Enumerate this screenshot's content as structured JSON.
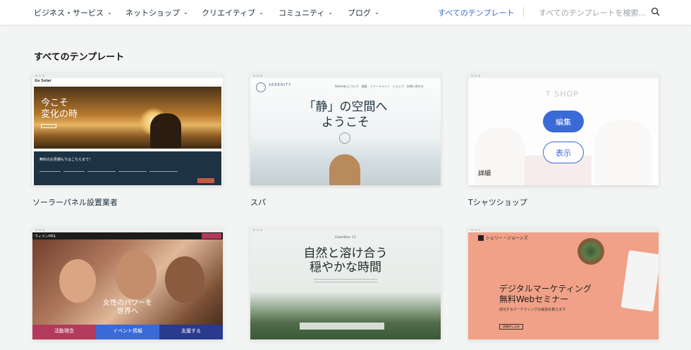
{
  "nav": {
    "items": [
      "ビジネス・サービス",
      "ネットショップ",
      "クリエイティブ",
      "コミュニティ",
      "ブログ"
    ],
    "active": "すべてのテンプレート",
    "search_placeholder": "すべてのテンプレートを検索..."
  },
  "page": {
    "title": "すべてのテンプレート"
  },
  "cards": [
    {
      "name": "ソーラーパネル設置業者",
      "preview": {
        "logo": "Go Solar",
        "headline": "今こそ\n変化の時",
        "form_title": "無料のお見積もりはこちらまで！"
      }
    },
    {
      "name": "スパ",
      "preview": {
        "brand": "SERENITY",
        "menu": "Serenity について　施設　トリートメント　ショップ　お問い合わせ",
        "headline": "「静」の空間へ\nようこそ"
      }
    },
    {
      "name": "Tシャツショップ",
      "preview": {
        "shop": "T SHOP",
        "detail": "詳細",
        "edit_label": "編集",
        "view_label": "表示"
      }
    },
    {
      "name": "",
      "preview": {
        "logo": "ウィメンPRS",
        "headline": "女性のパワーを\n世界へ",
        "tabs": [
          "活動理念",
          "イベント情報",
          "支援する"
        ]
      }
    },
    {
      "name": "",
      "preview": {
        "brand": "Giardino 12",
        "headline": "自然と溶け合う\n穏やかな時間"
      }
    },
    {
      "name": "",
      "preview": {
        "brand": "シェリー・ジョーンズ",
        "headline": "デジタルマーケティング\n無料Webセミナー",
        "sub": "成功するマーケティングの秘訣を教えます",
        "cta": "詳細申し込み"
      }
    }
  ],
  "colors": {
    "accent": "#3a6ad6",
    "pr_tabs": [
      "#b23a5c",
      "#3a6ad6",
      "#2a3a8c"
    ]
  }
}
